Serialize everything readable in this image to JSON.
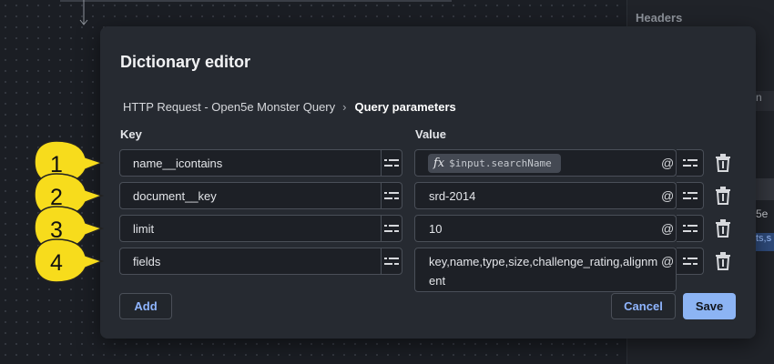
{
  "background": {
    "headers_label": "Headers",
    "strip1_text": "n",
    "strip3_text": "5e",
    "strip4_text": "ts,s"
  },
  "dialog": {
    "title": "Dictionary editor",
    "breadcrumb": {
      "parent": "HTTP Request - Open5e Monster Query",
      "separator": "›",
      "current": "Query parameters"
    },
    "columns": {
      "key": "Key",
      "value": "Value"
    },
    "rows": [
      {
        "key": "name__icontains",
        "value_type": "expression",
        "expression_icon": "fx",
        "value": "$input.searchName",
        "at": "@"
      },
      {
        "key": "document__key",
        "value": "srd-2014",
        "at": "@"
      },
      {
        "key": "limit",
        "value": "10",
        "at": "@"
      },
      {
        "key": "fields",
        "value": "key,name,type,size,challenge_rating,alignment",
        "at": "@"
      }
    ],
    "buttons": {
      "add": "Add",
      "cancel": "Cancel",
      "save": "Save"
    }
  },
  "callouts": [
    "1",
    "2",
    "3",
    "4"
  ],
  "colors": {
    "accent": "#8cb4f4",
    "callout_fill": "#f7dc1c",
    "dialog_bg": "#262a31"
  }
}
